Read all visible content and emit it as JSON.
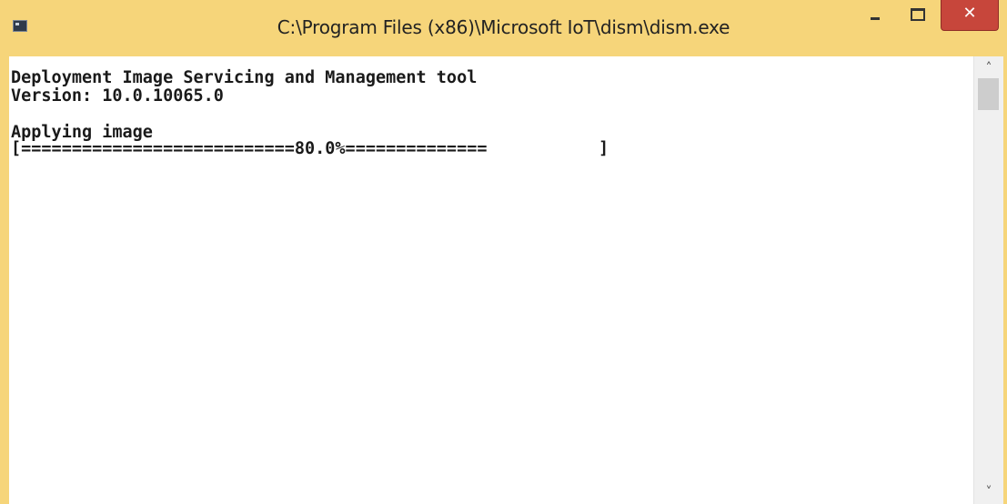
{
  "window": {
    "title": "C:\\Program Files (x86)\\Microsoft IoT\\dism\\dism.exe",
    "controls": {
      "minimize_icon": "minimize-icon",
      "maximize_icon": "maximize-icon",
      "close_label": "✕"
    },
    "colors": {
      "titlebar": "#f6d57a",
      "close_button": "#c7463b",
      "console_background": "#ffffff",
      "console_text": "#1a1a1a"
    }
  },
  "console": {
    "lines": [
      "Deployment Image Servicing and Management tool",
      "Version: 10.0.10065.0",
      "",
      "Applying image",
      "[===========================80.0%==============           ]"
    ],
    "progress_percent": 80.0
  },
  "scrollbar": {
    "up_arrow": "˄",
    "down_arrow": "˅"
  }
}
